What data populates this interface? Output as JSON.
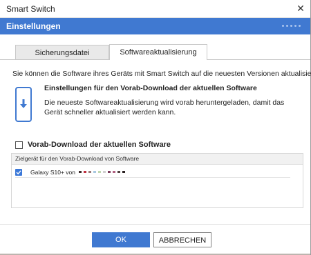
{
  "window": {
    "title": "Smart Switch",
    "close_glyph": "✕"
  },
  "header": {
    "title": "Einstellungen"
  },
  "tabs": [
    {
      "label": "Sicherungsdatei",
      "active": false
    },
    {
      "label": "Softwareaktualisierung",
      "active": true
    }
  ],
  "intro_text": "Sie können die Software ihres Geräts mit Smart Switch auf die neuesten Versionen aktualisieren.",
  "section": {
    "icon": "phone-download-icon",
    "title": "Einstellungen für den Vorab-Download der aktuellen Software",
    "description": "Die neueste Softwareaktualisierung wird vorab heruntergeladen, damit das Gerät schneller aktualisiert werden kann."
  },
  "predownload_checkbox": {
    "label": "Vorab-Download der aktuellen Software",
    "checked": false
  },
  "target_panel": {
    "header": "Zielgerät für den Vorab-Download von Software",
    "devices": [
      {
        "name": "Galaxy S10+ von",
        "checked": true
      }
    ]
  },
  "buttons": {
    "ok": "OK",
    "cancel": "ABBRECHEN"
  },
  "colors": {
    "accent": "#4079d1",
    "header_bg": "#4079d1"
  }
}
